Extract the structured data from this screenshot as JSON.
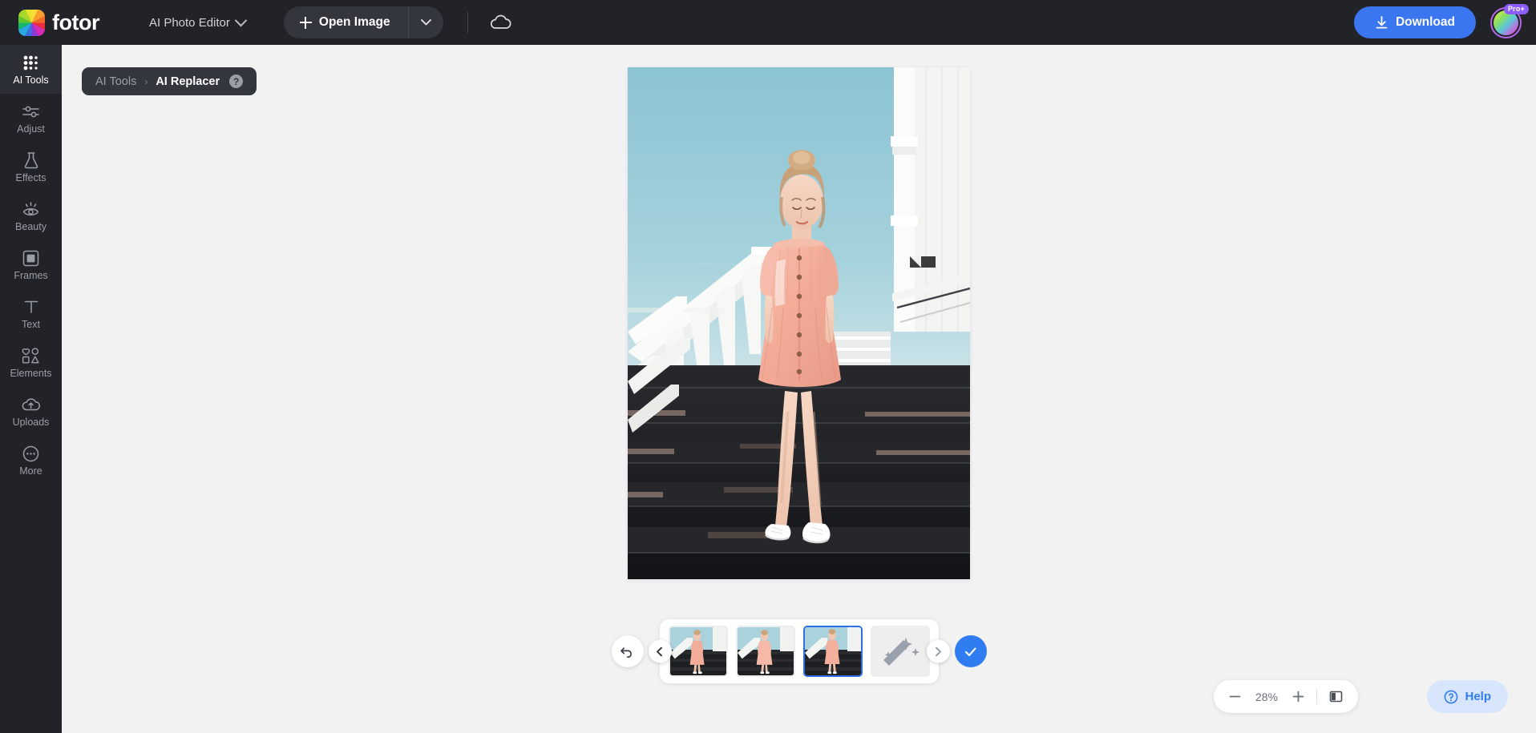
{
  "header": {
    "brand": "fotor",
    "brand_logo_icon": "fotor-color-wheel-logo",
    "app_switcher_label": "AI Photo Editor",
    "app_switcher_icon": "chevron-down-icon",
    "open_image_label": "Open Image",
    "open_image_plus_icon": "plus-icon",
    "open_image_caret_icon": "chevron-down-icon",
    "cloud_icon": "cloud-icon",
    "download_label": "Download",
    "download_icon": "download-arrow-icon",
    "avatar_icon": "user-avatar",
    "pro_badge": "Pro+",
    "accent_blue": "#3a76f0",
    "header_bg": "#212329"
  },
  "sidebar": {
    "items": [
      {
        "label": "AI Tools",
        "icon": "grid-dots-icon",
        "active": true
      },
      {
        "label": "Adjust",
        "icon": "sliders-icon",
        "active": false
      },
      {
        "label": "Effects",
        "icon": "flask-icon",
        "active": false
      },
      {
        "label": "Beauty",
        "icon": "eye-sparkle-icon",
        "active": false
      },
      {
        "label": "Frames",
        "icon": "frame-icon",
        "active": false
      },
      {
        "label": "Text",
        "icon": "text-t-icon",
        "active": false
      },
      {
        "label": "Elements",
        "icon": "shapes-icon",
        "active": false
      },
      {
        "label": "Uploads",
        "icon": "cloud-upload-icon",
        "active": false
      },
      {
        "label": "More",
        "icon": "more-dots-icon",
        "active": false
      }
    ]
  },
  "breadcrumb": {
    "parent": "AI Tools",
    "separator": "›",
    "current": "AI Replacer",
    "help_icon": "question-mark-icon",
    "help_glyph": "?"
  },
  "canvas": {
    "image_alt": "Woman in pink off-shoulder dress walking down dark stairs",
    "sky_color": "#8ec4d4",
    "dress_color": "#f4b6a6",
    "stairs_color": "#1b1d20"
  },
  "bottom": {
    "undo_icon": "undo-arrow-icon",
    "prev_icon": "chevron-left-icon",
    "next_icon": "chevron-right-icon",
    "confirm_icon": "check-icon",
    "placeholder_icon": "magic-wand-icon",
    "variants": [
      {
        "name": "variant-1",
        "selected": false
      },
      {
        "name": "variant-2",
        "selected": false
      },
      {
        "name": "variant-3",
        "selected": true
      },
      {
        "name": "variant-placeholder",
        "selected": false
      }
    ]
  },
  "zoombar": {
    "minus_icon": "minus-icon",
    "zoom_value": "28%",
    "plus_icon": "plus-icon",
    "compare_icon": "compare-split-icon"
  },
  "help": {
    "label": "Help",
    "icon": "question-circle-icon"
  }
}
